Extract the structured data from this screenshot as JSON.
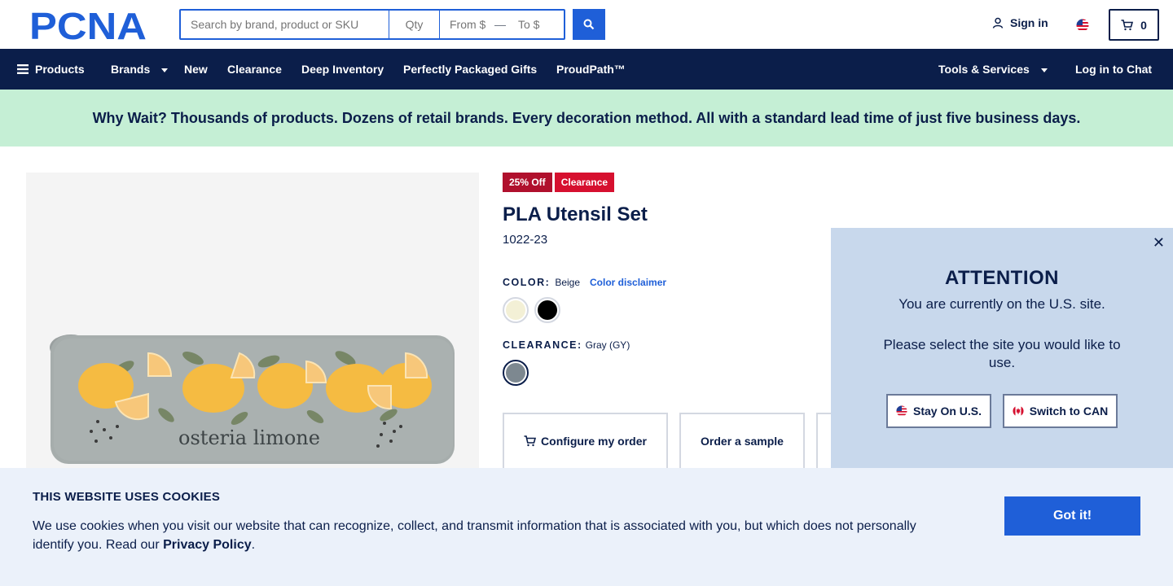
{
  "header": {
    "logo_text": "PCNA",
    "search_placeholder": "Search by brand, product or SKU",
    "qty_placeholder": "Qty",
    "from_placeholder": "From $",
    "to_placeholder": "To $",
    "sign_in": "Sign in",
    "cart_count": "0"
  },
  "nav": {
    "products": "Products",
    "brands": "Brands",
    "new": "New",
    "clearance": "Clearance",
    "deep_inventory": "Deep Inventory",
    "gifts": "Perfectly Packaged Gifts",
    "proudpath": "ProudPath™",
    "tools": "Tools & Services",
    "chat": "Log in to Chat"
  },
  "promo": {
    "text": "Why Wait? Thousands of products. Dozens of retail brands. Every decoration method. All with a standard lead time of just five business days."
  },
  "product": {
    "badge_discount": "25% Off",
    "badge_clearance": "Clearance",
    "title": "PLA Utensil Set",
    "sku": "1022-23",
    "color_label": "COLOR:",
    "color_value": "Beige",
    "color_disclaimer": "Color disclaimer",
    "clearance_label": "CLEARANCE:",
    "clearance_value": "Gray (GY)",
    "swatches": [
      {
        "name": "Beige",
        "hex": "#f3f0d6"
      },
      {
        "name": "Black",
        "hex": "#000000"
      }
    ],
    "clearance_swatch": {
      "name": "Gray",
      "hex": "#7d8890"
    },
    "image_caption": "osteria limone",
    "actions": {
      "configure": "Configure my order",
      "sample": "Order a sample"
    }
  },
  "attention": {
    "title": "ATTENTION",
    "message1": "You are currently on the U.S. site.",
    "message2": "Please select the site you would like to use.",
    "stay": "Stay On U.S.",
    "switch": "Switch to CAN"
  },
  "cookie": {
    "title": "THIS WEBSITE USES COOKIES",
    "text_before": "We use cookies when you visit our website that can recognize, collect, and transmit information that is associated with you, but which does not personally identify you. Read our ",
    "link": "Privacy Policy",
    "text_after": ".",
    "button": "Got it!"
  },
  "colors": {
    "navy": "#0b1e4a",
    "accent_blue": "#1f5fd8",
    "promo_green": "#c5efd5",
    "badge_red": "#d6102f",
    "attention_bg": "#c8d8ec",
    "cookie_bg": "#ebf1fa"
  }
}
